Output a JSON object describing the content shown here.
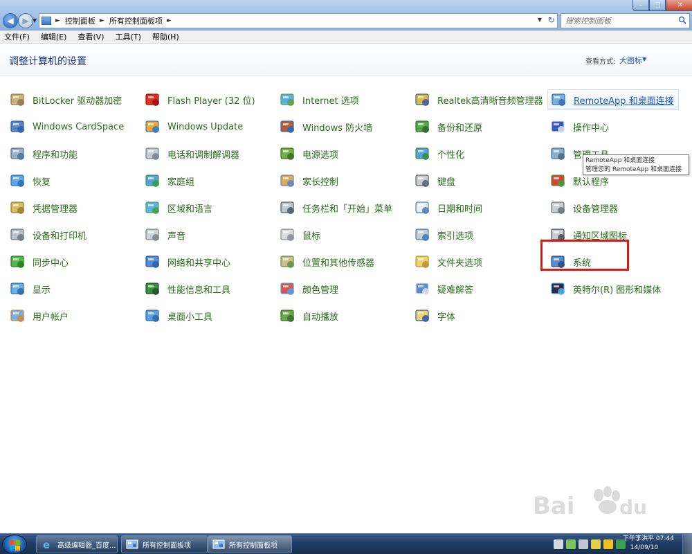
{
  "address_bar": {
    "breadcrumbs": [
      "控制面板",
      "所有控制面板项"
    ],
    "search_placeholder": "搜索控制面板"
  },
  "menu": {
    "items": [
      "文件(F)",
      "编辑(E)",
      "查看(V)",
      "工具(T)",
      "帮助(H)"
    ]
  },
  "header": {
    "title": "调整计算机的设置",
    "view_label": "查看方式:",
    "view_value": "大图标"
  },
  "items": [
    {
      "label": "BitLocker 驱动器加密",
      "icon": "bitlocker-key-icon"
    },
    {
      "label": "Windows CardSpace",
      "icon": "cardspace-icon"
    },
    {
      "label": "程序和功能",
      "icon": "programs-features-icon"
    },
    {
      "label": "恢复",
      "icon": "recovery-icon"
    },
    {
      "label": "凭据管理器",
      "icon": "credential-manager-icon"
    },
    {
      "label": "设备和打印机",
      "icon": "printer-icon"
    },
    {
      "label": "同步中心",
      "icon": "sync-center-icon"
    },
    {
      "label": "显示",
      "icon": "display-monitor-icon"
    },
    {
      "label": "用户帐户",
      "icon": "user-accounts-icon"
    },
    {
      "label": "Flash Player (32 位)",
      "icon": "flash-player-icon"
    },
    {
      "label": "Windows Update",
      "icon": "windows-update-icon"
    },
    {
      "label": "电话和调制解调器",
      "icon": "phone-modem-icon"
    },
    {
      "label": "家庭组",
      "icon": "homegroup-icon"
    },
    {
      "label": "区域和语言",
      "icon": "globe-clock-icon"
    },
    {
      "label": "声音",
      "icon": "speaker-icon"
    },
    {
      "label": "网络和共享中心",
      "icon": "network-sharing-icon"
    },
    {
      "label": "性能信息和工具",
      "icon": "performance-chart-icon"
    },
    {
      "label": "桌面小工具",
      "icon": "desktop-gadgets-icon"
    },
    {
      "label": "Internet 选项",
      "icon": "internet-options-icon"
    },
    {
      "label": "Windows 防火墙",
      "icon": "firewall-icon"
    },
    {
      "label": "电源选项",
      "icon": "power-options-icon"
    },
    {
      "label": "家长控制",
      "icon": "parental-controls-icon"
    },
    {
      "label": "任务栏和「开始」菜单",
      "icon": "taskbar-start-menu-icon"
    },
    {
      "label": "鼠标",
      "icon": "mouse-icon"
    },
    {
      "label": "位置和其他传感器",
      "icon": "location-sensors-icon"
    },
    {
      "label": "颜色管理",
      "icon": "color-management-icon"
    },
    {
      "label": "自动播放",
      "icon": "autoplay-icon"
    },
    {
      "label": "Realtek高清晰音频管理器",
      "icon": "realtek-audio-icon"
    },
    {
      "label": "备份和还原",
      "icon": "backup-restore-icon"
    },
    {
      "label": "个性化",
      "icon": "personalization-icon"
    },
    {
      "label": "键盘",
      "icon": "keyboard-icon"
    },
    {
      "label": "日期和时间",
      "icon": "calendar-clock-icon"
    },
    {
      "label": "索引选项",
      "icon": "indexing-options-icon"
    },
    {
      "label": "文件夹选项",
      "icon": "folder-options-icon"
    },
    {
      "label": "疑难解答",
      "icon": "troubleshooting-icon"
    },
    {
      "label": "字体",
      "icon": "fonts-icon"
    },
    {
      "label": "RemoteApp 和桌面连接",
      "icon": "remoteapp-icon"
    },
    {
      "label": "操作中心",
      "icon": "action-center-flag-icon"
    },
    {
      "label": "管理工具",
      "icon": "admin-tools-icon"
    },
    {
      "label": "默认程序",
      "icon": "default-programs-icon"
    },
    {
      "label": "设备管理器",
      "icon": "device-manager-icon"
    },
    {
      "label": "通知区域图标",
      "icon": "notification-area-icon"
    },
    {
      "label": "系统",
      "icon": "system-icon"
    },
    {
      "label": "英特尔(R) 图形和媒体",
      "icon": "intel-graphics-icon"
    }
  ],
  "tooltip": {
    "line1": "RemoteApp 和桌面连接",
    "line2": "管理您的 RemoteApp 和桌面连接"
  },
  "taskbar": {
    "buttons": [
      "高级编辑器_百度...",
      "所有控制面板项",
      "所有控制面板项"
    ],
    "clock_line1": "下午李洪平 07:44",
    "clock_line2": "14/09/10"
  },
  "colors": {
    "link_green": "#2a6e1c",
    "title_blue": "#1e3287",
    "highlight_red": "#d41c1c"
  }
}
